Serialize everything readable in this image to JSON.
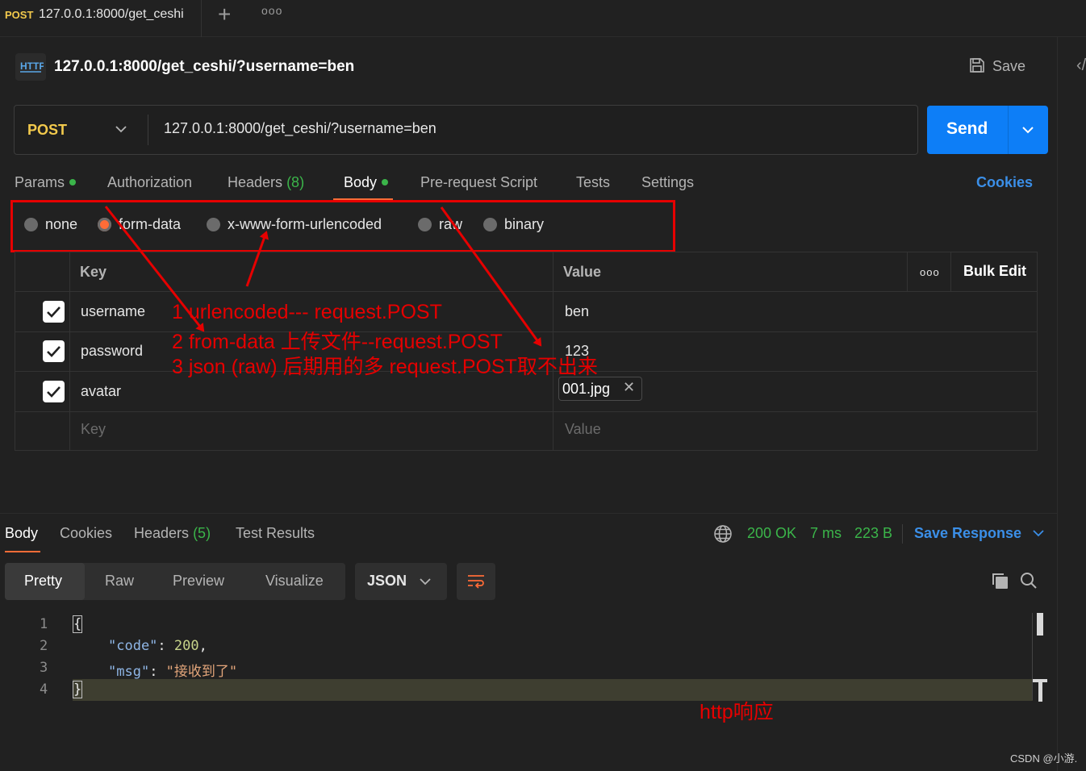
{
  "tab": {
    "method": "POST",
    "url": "127.0.0.1:8000/get_ceshi"
  },
  "request": {
    "title": "127.0.0.1:8000/get_ceshi/?username=ben",
    "save_label": "Save",
    "method": "POST",
    "url": "127.0.0.1:8000/get_ceshi/?username=ben",
    "send_label": "Send"
  },
  "request_tabs": {
    "params": "Params",
    "authorization": "Authorization",
    "headers": "Headers",
    "headers_count": "(8)",
    "body": "Body",
    "pre_request": "Pre-request Script",
    "tests": "Tests",
    "settings": "Settings",
    "cookies": "Cookies"
  },
  "body_types": {
    "none": "none",
    "form_data": "form-data",
    "urlencoded": "x-www-form-urlencoded",
    "raw": "raw",
    "binary": "binary",
    "selected": "form-data"
  },
  "form_table": {
    "key_header": "Key",
    "value_header": "Value",
    "bulk_edit": "Bulk Edit",
    "rows": [
      {
        "key": "username",
        "value": "ben",
        "checked": true
      },
      {
        "key": "password",
        "value": "123",
        "checked": true
      },
      {
        "key": "avatar",
        "value": "001.jpg",
        "checked": true
      }
    ],
    "key_placeholder": "Key",
    "value_placeholder": "Value"
  },
  "annotations": {
    "line1": "1 urlencoded--- request.POST",
    "line2": "2 from-data 上传文件--request.POST",
    "line3": "3 json (raw)   后期用的多  request.POST取不出来",
    "response_note": "http响应"
  },
  "response": {
    "tabs": {
      "body": "Body",
      "cookies": "Cookies",
      "headers": "Headers",
      "headers_count": "(5)",
      "test_results": "Test Results"
    },
    "status": "200 OK",
    "time": "7 ms",
    "size": "223 B",
    "save_response": "Save Response",
    "views": {
      "pretty": "Pretty",
      "raw": "Raw",
      "preview": "Preview",
      "visualize": "Visualize"
    },
    "format": "JSON",
    "lines": [
      {
        "num": "1",
        "text": "{"
      },
      {
        "num": "2",
        "key": "\"code\"",
        "sep": ": ",
        "value": "200",
        "end": ","
      },
      {
        "num": "3",
        "key": "\"msg\"",
        "sep": ": ",
        "value": "\"接收到了\"",
        "end": ""
      },
      {
        "num": "4",
        "text": "}"
      }
    ]
  },
  "colors": {
    "accent": "#ff6c37",
    "send": "#0d7ef7",
    "link": "#3b8fe8",
    "success": "#3bb54a",
    "annotation": "#e60000"
  },
  "watermark": "CSDN @小游."
}
